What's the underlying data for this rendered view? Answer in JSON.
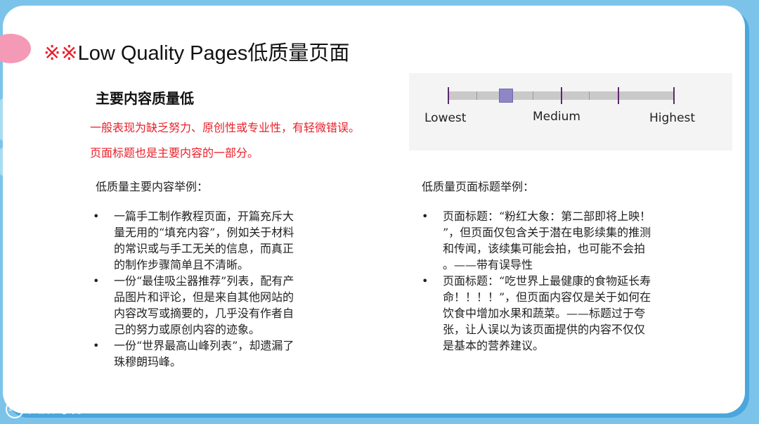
{
  "title": {
    "marks": "※※",
    "text": "Low Quality Pages低质量页面"
  },
  "subtitle": "主要内容质量低",
  "red_lines": [
    "一般表现为缺乏努力、原创性或专业性，有轻微错误。",
    "页面标题也是主要内容的一部分。"
  ],
  "scale": {
    "labels": {
      "low": "Lowest",
      "medium": "Medium",
      "high": "Highest"
    },
    "level_fraction": 0.25,
    "colors": {
      "bar": "#c9c9c9",
      "tick": "#5b2a6e",
      "thumb": "#8f86c8"
    }
  },
  "left_column": {
    "heading": "低质量主要内容举例：",
    "items": [
      [
        "一篇手工制作教程页面，开篇充斥大",
        "量无用的“填充内容”，例如关于材料",
        "的常识或与手工无关的信息，而真正",
        "的制作步骤简单且不清晰。"
      ],
      [
        "一份“最佳吸尘器推荐”列表，配有产",
        "品图片和评论，但是来自其他网站的",
        "内容改写或摘要的，几乎没有作者自",
        "己的努力或原创内容的迹象。"
      ],
      [
        "一份“世界最高山峰列表”，却遗漏了",
        "珠穆朗玛峰。"
      ]
    ]
  },
  "right_column": {
    "heading": "低质量页面标题举例：",
    "items": [
      [
        "页面标题：“粉红大象：第二部即将上映！",
        "”，但页面仅包含关于潜在电影续集的推测",
        "和传闻，该续集可能会拍，也可能不会拍",
        "。——带有误导性"
      ],
      [
        "页面标题：“吃世界上最健康的食物延长寿",
        "命！！！！”，但页面内容仅是关于如何在",
        "饮食中增加水果和蔬菜。——标题过于夸",
        "张，让人误以为该页面提供的内容不仅仅",
        "是基本的营养建议。"
      ]
    ]
  },
  "watermark": "大数跨境",
  "colors": {
    "accent_red": "#e8202a",
    "background": "#7cc3ea",
    "pink": "#f49ab6"
  }
}
